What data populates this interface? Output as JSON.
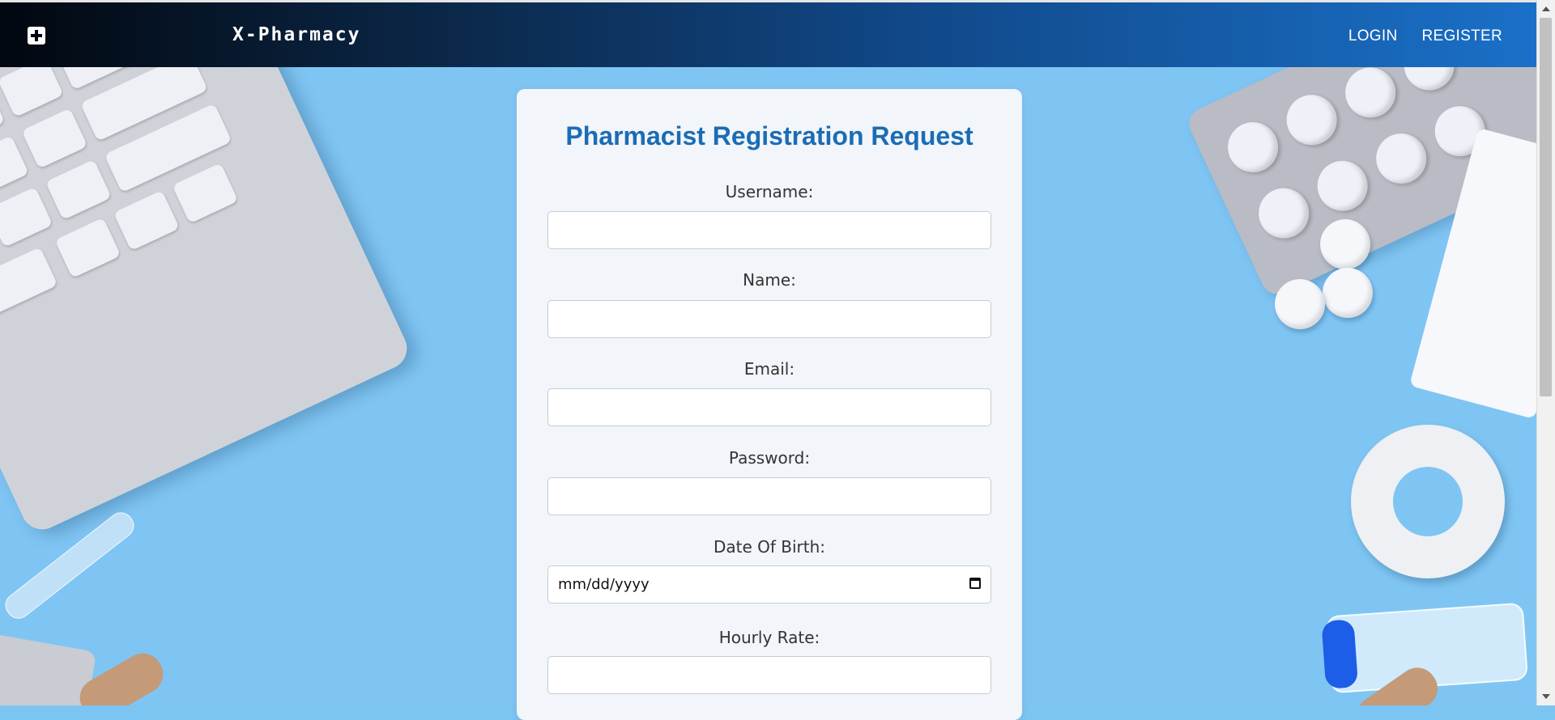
{
  "header": {
    "brand": "X-Pharmacy",
    "logo_icon": "medical-cross-icon",
    "nav": {
      "login": "LOGIN",
      "register": "REGISTER"
    }
  },
  "form": {
    "title": "Pharmacist Registration Request",
    "fields": {
      "username": {
        "label": "Username:",
        "value": ""
      },
      "name": {
        "label": "Name:",
        "value": ""
      },
      "email": {
        "label": "Email:",
        "value": ""
      },
      "password": {
        "label": "Password:",
        "value": ""
      },
      "dob": {
        "label": "Date Of Birth:",
        "placeholder": "mm/dd/yyyy"
      },
      "hourly_rate": {
        "label": "Hourly Rate:",
        "value": ""
      }
    }
  },
  "colors": {
    "accent": "#1b6cb5",
    "header_start": "#02070f",
    "header_end": "#1a70c8"
  }
}
